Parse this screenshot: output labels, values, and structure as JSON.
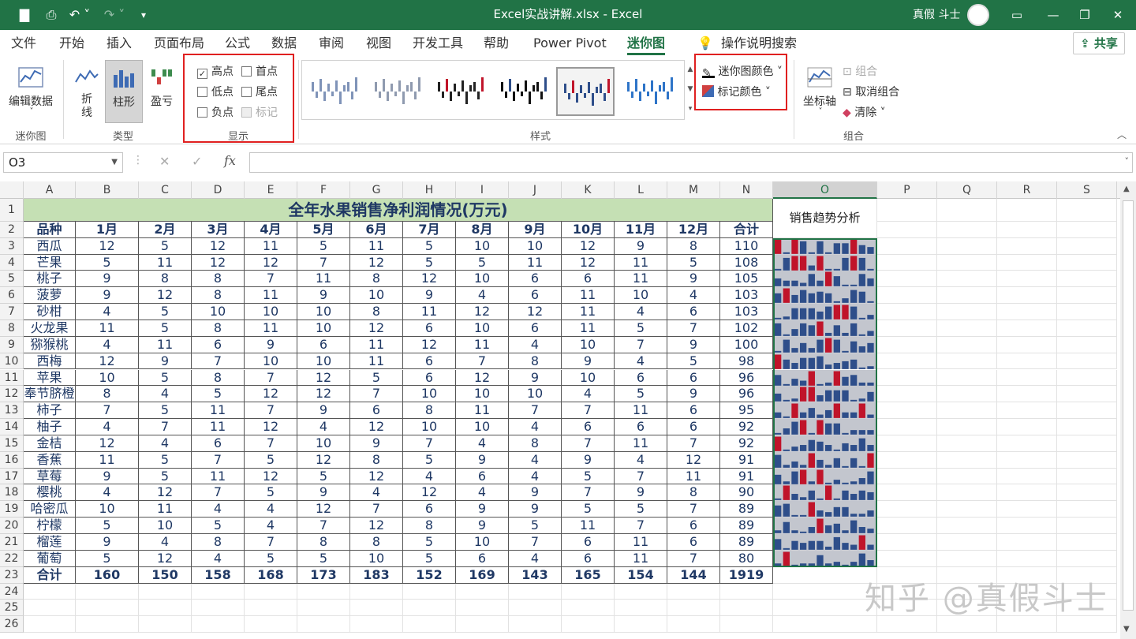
{
  "window": {
    "title": "Excel实战讲解.xlsx  -  Excel",
    "user": "真假 斗士"
  },
  "menu": [
    "文件",
    "开始",
    "插入",
    "页面布局",
    "公式",
    "数据",
    "审阅",
    "视图",
    "开发工具",
    "帮助",
    "Power Pivot",
    "迷你图",
    "操作说明搜索"
  ],
  "share_label": "共享",
  "ribbon": {
    "edit_data": "编辑数据",
    "group_sparkline": "迷你图",
    "type_line": "折\n线",
    "type_column": "柱形",
    "type_winloss": "盈亏",
    "group_type": "类型",
    "show": {
      "high": "高点",
      "first": "首点",
      "low": "低点",
      "last": "尾点",
      "negative": "负点",
      "markers": "标记"
    },
    "group_show": "显示",
    "group_style": "样式",
    "sparkline_color": "迷你图颜色",
    "marker_color": "标记颜色",
    "axis": "坐标轴",
    "group_combine": "组合",
    "ungroup": "取消组合",
    "clear": "清除",
    "group_group": "组合"
  },
  "formula_bar": {
    "name_box": "O3",
    "fx": "fx",
    "cancel": "✕",
    "enter": "✓"
  },
  "columns": [
    "A",
    "B",
    "C",
    "D",
    "E",
    "F",
    "G",
    "H",
    "I",
    "J",
    "K",
    "L",
    "M",
    "N",
    "O",
    "P",
    "Q",
    "R",
    "S"
  ],
  "sheet": {
    "title": "全年水果销售净利润情况(万元)",
    "o1_label": "销售趋势分析",
    "headers": [
      "品种",
      "1月",
      "2月",
      "3月",
      "4月",
      "5月",
      "6月",
      "7月",
      "8月",
      "9月",
      "10月",
      "11月",
      "12月",
      "合计"
    ],
    "rows": [
      {
        "name": "西瓜",
        "v": [
          12,
          5,
          12,
          11,
          5,
          11,
          5,
          10,
          10,
          12,
          9,
          8
        ],
        "total": 110
      },
      {
        "name": "芒果",
        "v": [
          5,
          11,
          12,
          12,
          7,
          12,
          5,
          5,
          11,
          12,
          11,
          5
        ],
        "total": 108
      },
      {
        "name": "桃子",
        "v": [
          9,
          8,
          8,
          7,
          11,
          8,
          12,
          10,
          6,
          6,
          11,
          9
        ],
        "total": 105
      },
      {
        "name": "菠萝",
        "v": [
          9,
          12,
          8,
          11,
          9,
          10,
          9,
          4,
          6,
          11,
          10,
          4
        ],
        "total": 103
      },
      {
        "name": "砂柑",
        "v": [
          4,
          5,
          10,
          10,
          10,
          8,
          11,
          12,
          12,
          11,
          4,
          6
        ],
        "total": 103
      },
      {
        "name": "火龙果",
        "v": [
          11,
          5,
          8,
          11,
          10,
          12,
          6,
          10,
          6,
          11,
          5,
          7
        ],
        "total": 102
      },
      {
        "name": "猕猴桃",
        "v": [
          4,
          11,
          6,
          9,
          6,
          11,
          12,
          11,
          4,
          10,
          7,
          9
        ],
        "total": 100
      },
      {
        "name": "西梅",
        "v": [
          12,
          9,
          7,
          10,
          10,
          11,
          6,
          7,
          8,
          9,
          4,
          5
        ],
        "total": 98
      },
      {
        "name": "苹果",
        "v": [
          10,
          5,
          8,
          7,
          12,
          5,
          6,
          12,
          9,
          10,
          6,
          6
        ],
        "total": 96
      },
      {
        "name": "奉节脐橙",
        "v": [
          8,
          4,
          5,
          12,
          12,
          7,
          10,
          10,
          10,
          4,
          5,
          9
        ],
        "total": 96
      },
      {
        "name": "柿子",
        "v": [
          7,
          5,
          11,
          7,
          9,
          6,
          8,
          11,
          7,
          7,
          11,
          6
        ],
        "total": 95
      },
      {
        "name": "柚子",
        "v": [
          4,
          7,
          11,
          12,
          4,
          12,
          10,
          10,
          4,
          6,
          6,
          6
        ],
        "total": 92
      },
      {
        "name": "金桔",
        "v": [
          12,
          4,
          6,
          7,
          10,
          9,
          7,
          4,
          8,
          7,
          11,
          7
        ],
        "total": 92
      },
      {
        "name": "香蕉",
        "v": [
          11,
          5,
          7,
          5,
          12,
          8,
          5,
          9,
          4,
          9,
          4,
          12
        ],
        "total": 91
      },
      {
        "name": "草莓",
        "v": [
          9,
          5,
          11,
          12,
          5,
          12,
          4,
          6,
          4,
          5,
          7,
          11
        ],
        "total": 91
      },
      {
        "name": "樱桃",
        "v": [
          4,
          12,
          7,
          5,
          9,
          4,
          12,
          4,
          9,
          7,
          9,
          8
        ],
        "total": 90
      },
      {
        "name": "哈密瓜",
        "v": [
          10,
          11,
          4,
          4,
          12,
          7,
          6,
          9,
          9,
          5,
          5,
          7
        ],
        "total": 89
      },
      {
        "name": "柠檬",
        "v": [
          5,
          10,
          5,
          4,
          7,
          12,
          8,
          9,
          5,
          11,
          7,
          6
        ],
        "total": 89
      },
      {
        "name": "榴莲",
        "v": [
          9,
          4,
          8,
          7,
          8,
          8,
          5,
          10,
          7,
          6,
          11,
          6
        ],
        "total": 89
      },
      {
        "name": "葡萄",
        "v": [
          5,
          12,
          4,
          5,
          5,
          10,
          5,
          6,
          4,
          6,
          11,
          7
        ],
        "total": 80
      }
    ],
    "totals_label": "合计",
    "totals": [
      160,
      150,
      158,
      168,
      173,
      183,
      152,
      169,
      143,
      165,
      154,
      144,
      1919
    ]
  },
  "sparkline_colors": {
    "bar": "#2e4e8a",
    "high": "#c0142a",
    "bg": "#c3c6ce"
  },
  "watermark": "知乎 @真假斗士"
}
